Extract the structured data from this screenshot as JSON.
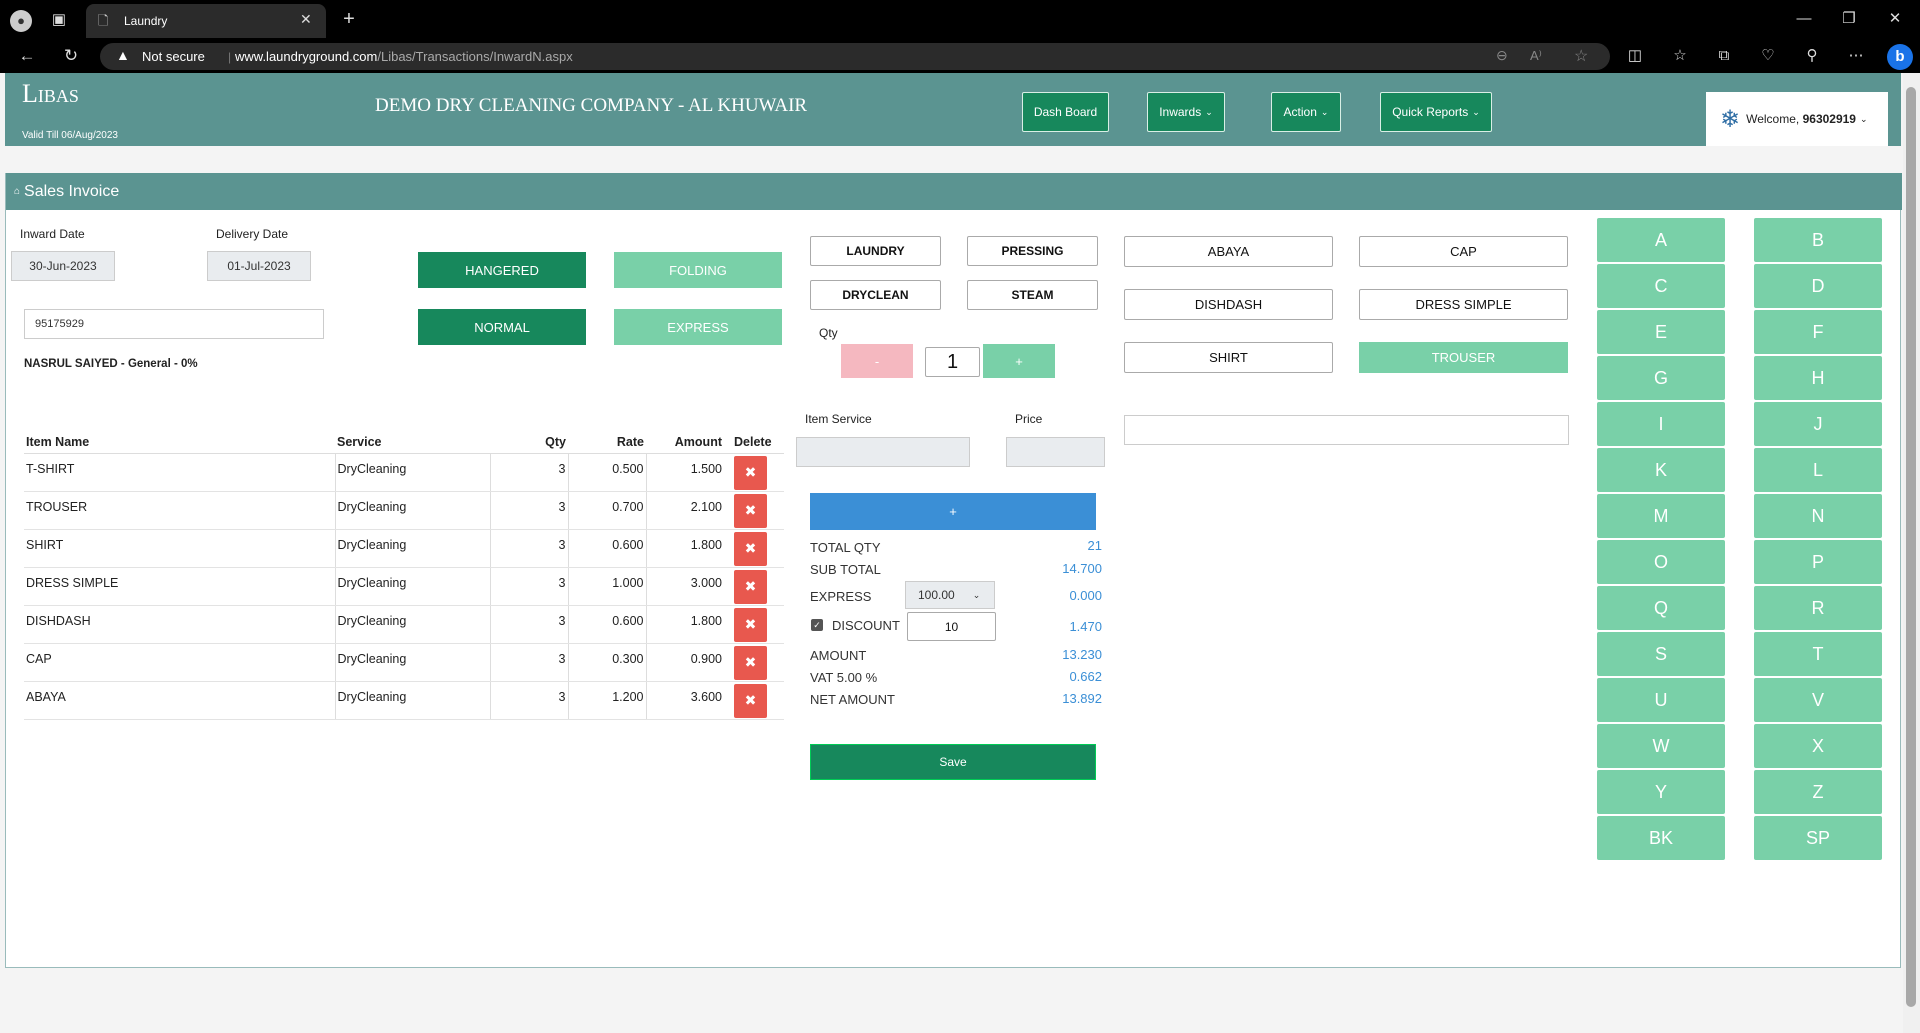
{
  "browser": {
    "tab_title": "Laundry",
    "security": "Not secure",
    "url_domain": "www.laundryground.com",
    "url_path": "/Libas/Transactions/InwardN.aspx",
    "font_size_indicator": "A⁾"
  },
  "header": {
    "logo": "Libas",
    "valid_till": "Valid Till 06/Aug/2023",
    "company": "DEMO DRY CLEANING COMPANY - AL KHUWAIR",
    "nav": {
      "dashboard": "Dash Board",
      "inwards": "Inwards",
      "action": "Action",
      "quick_reports": "Quick Reports"
    },
    "welcome_prefix": "Welcome,",
    "user": "96302919"
  },
  "section": {
    "title": "Sales Invoice"
  },
  "form": {
    "inward_date_label": "Inward Date",
    "inward_date": "30-Jun-2023",
    "delivery_date_label": "Delivery Date",
    "delivery_date": "01-Jul-2023",
    "customer_phone": "95175929",
    "customer_info": "NASRUL SAIYED - General - 0%",
    "hangered": "HANGERED",
    "folding": "FOLDING",
    "normal": "NORMAL",
    "express": "EXPRESS"
  },
  "services": [
    "LAUNDRY",
    "PRESSING",
    "DRYCLEAN",
    "STEAM"
  ],
  "qty": {
    "label": "Qty",
    "minus": "-",
    "value": "1",
    "plus": "+"
  },
  "item_service_label": "Item Service",
  "price_label": "Price",
  "add_button": "+",
  "garments": [
    "ABAYA",
    "CAP",
    "DISHDASH",
    "DRESS SIMPLE",
    "SHIRT",
    "TROUSER"
  ],
  "table": {
    "headers": [
      "Item Name",
      "Service",
      "Qty",
      "Rate",
      "Amount",
      "Delete"
    ],
    "rows": [
      {
        "item": "T-SHIRT",
        "service": "DryCleaning",
        "qty": "3",
        "rate": "0.500",
        "amount": "1.500"
      },
      {
        "item": "TROUSER",
        "service": "DryCleaning",
        "qty": "3",
        "rate": "0.700",
        "amount": "2.100"
      },
      {
        "item": "SHIRT",
        "service": "DryCleaning",
        "qty": "3",
        "rate": "0.600",
        "amount": "1.800"
      },
      {
        "item": "DRESS SIMPLE",
        "service": "DryCleaning",
        "qty": "3",
        "rate": "1.000",
        "amount": "3.000"
      },
      {
        "item": "DISHDASH",
        "service": "DryCleaning",
        "qty": "3",
        "rate": "0.600",
        "amount": "1.800"
      },
      {
        "item": "CAP",
        "service": "DryCleaning",
        "qty": "3",
        "rate": "0.300",
        "amount": "0.900"
      },
      {
        "item": "ABAYA",
        "service": "DryCleaning",
        "qty": "3",
        "rate": "1.200",
        "amount": "3.600"
      }
    ],
    "delete_glyph": "✖"
  },
  "summary": {
    "total_qty_label": "TOTAL QTY",
    "total_qty": "21",
    "sub_total_label": "SUB TOTAL",
    "sub_total": "14.700",
    "express_label": "EXPRESS",
    "express_select": "100.00",
    "express": "0.000",
    "discount_label": "DISCOUNT",
    "discount_input": "10",
    "discount": "1.470",
    "amount_label": "AMOUNT",
    "amount": "13.230",
    "vat_label": "VAT 5.00 %",
    "vat": "0.662",
    "net_label": "NET AMOUNT",
    "net": "13.892",
    "save": "Save"
  },
  "letters": [
    "A",
    "B",
    "C",
    "D",
    "E",
    "F",
    "G",
    "H",
    "I",
    "J",
    "K",
    "L",
    "M",
    "N",
    "O",
    "P",
    "Q",
    "R",
    "S",
    "T",
    "U",
    "V",
    "W",
    "X",
    "Y",
    "Z",
    "BK",
    "SP"
  ],
  "colors": {
    "header": "#5b9491",
    "dark_green": "#17885c",
    "light_green": "#79d0a8",
    "blue": "#3b8fd6",
    "delete_red": "#e8584e"
  }
}
